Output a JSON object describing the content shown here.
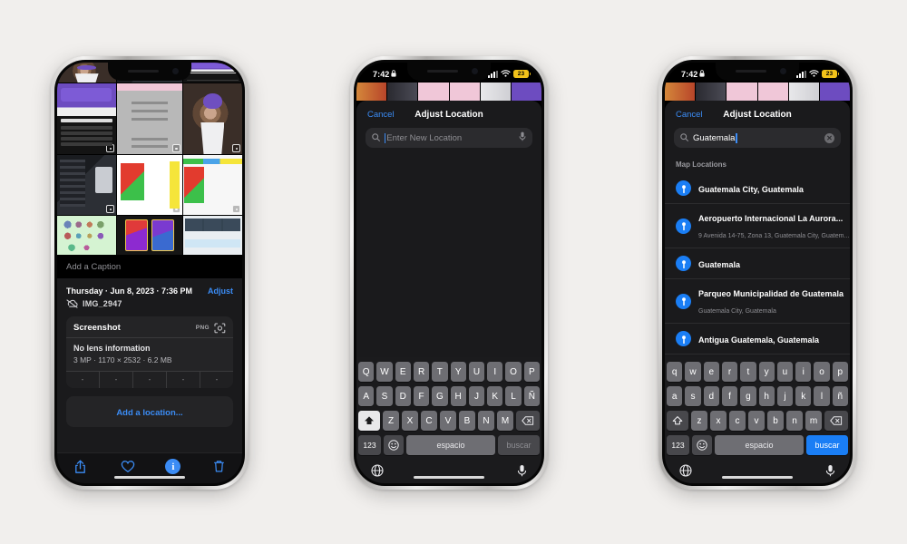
{
  "page": {
    "background": "#f1efed",
    "accent_blue": "#3b8cf5",
    "pin_blue": "#1a7ef5",
    "battery_yellow": "#f2c21a"
  },
  "status_bar": {
    "time": "7:42",
    "lock_icon": "lock-icon",
    "signal_icon": "cellular-bars-icon",
    "wifi_icon": "wifi-icon",
    "battery_level": "23"
  },
  "phone1": {
    "name": "photo-detail-screen",
    "caption_placeholder": "Add a Caption",
    "date_line": "Thursday · Jun 8, 2023 · 7:36 PM",
    "adjust_label": "Adjust",
    "filename": "IMG_2947",
    "cloud_icon": "cloud-slash-icon",
    "metadata": {
      "title": "Screenshot",
      "format_badge": "PNG",
      "lens_icon": "lens-info-icon",
      "lens_line": "No lens information",
      "size_line": "3 MP · 1170 × 2532 · 6.2 MB",
      "exif_cells": [
        "-",
        "-",
        "-",
        "-",
        "-"
      ]
    },
    "add_location_label": "Add a location...",
    "toolbar": [
      {
        "name": "share-icon",
        "glyph": "share"
      },
      {
        "name": "heart-icon",
        "glyph": "heart"
      },
      {
        "name": "info-icon",
        "glyph": "i"
      },
      {
        "name": "trash-icon",
        "glyph": "trash"
      }
    ],
    "collage_tiles": [
      "news-article-screenshot",
      "document-screenshot",
      "game-avatar-screenshot",
      "dark-app-ui-screenshot",
      "spreadsheet-red-green-screenshot",
      "spreadsheet-colored-screenshot",
      "pokemon-grid-screenshot",
      "trading-cards-screenshot",
      "pricing-table-screenshot"
    ]
  },
  "phone2": {
    "name": "adjust-location-empty-search",
    "nav": {
      "cancel": "Cancel",
      "title": "Adjust Location"
    },
    "search": {
      "placeholder": "Enter New Location",
      "value": "",
      "search_icon": "search-icon",
      "mic_icon": "microphone-icon"
    },
    "keyboard": {
      "layout": "spanish-uppercase",
      "row1": [
        "Q",
        "W",
        "E",
        "R",
        "T",
        "Y",
        "U",
        "I",
        "O",
        "P"
      ],
      "row2": [
        "A",
        "S",
        "D",
        "F",
        "G",
        "H",
        "J",
        "K",
        "L",
        "Ñ"
      ],
      "row3": [
        "Z",
        "X",
        "C",
        "V",
        "B",
        "N",
        "M"
      ],
      "shift_icon": "shift-filled-icon",
      "delete_icon": "backspace-icon",
      "numbers_key": "123",
      "emoji_icon": "emoji-icon",
      "space_key": "espacio",
      "return_key": "buscar",
      "return_active": false,
      "globe_icon": "globe-icon",
      "mic_icon": "microphone-icon"
    }
  },
  "phone3": {
    "name": "adjust-location-search-results",
    "nav": {
      "cancel": "Cancel",
      "title": "Adjust Location"
    },
    "search": {
      "placeholder": "Enter New Location",
      "value": "Guatemala",
      "search_icon": "search-icon",
      "clear_icon": "clear-circle-icon"
    },
    "results_header": "Map Locations",
    "results": [
      {
        "title": "Guatemala City, Guatemala",
        "subtitle": ""
      },
      {
        "title": "Aeropuerto Internacional La Aurora...",
        "subtitle": "9 Avenida 14-75, Zona 13, Guatemala City, Guatem..."
      },
      {
        "title": "Guatemala",
        "subtitle": ""
      },
      {
        "title": "Parqueo Municipalidad de Guatemala",
        "subtitle": "Guatemala City, Guatemala"
      },
      {
        "title": "Antigua Guatemala, Guatemala",
        "subtitle": ""
      }
    ],
    "keyboard": {
      "layout": "spanish-lowercase",
      "row1": [
        "q",
        "w",
        "e",
        "r",
        "t",
        "y",
        "u",
        "i",
        "o",
        "p"
      ],
      "row2": [
        "a",
        "s",
        "d",
        "f",
        "g",
        "h",
        "j",
        "k",
        "l",
        "ñ"
      ],
      "row3": [
        "z",
        "x",
        "c",
        "v",
        "b",
        "n",
        "m"
      ],
      "shift_icon": "shift-outline-icon",
      "delete_icon": "backspace-icon",
      "numbers_key": "123",
      "emoji_icon": "emoji-icon",
      "space_key": "espacio",
      "return_key": "buscar",
      "return_active": true,
      "globe_icon": "globe-icon",
      "mic_icon": "microphone-icon"
    }
  }
}
